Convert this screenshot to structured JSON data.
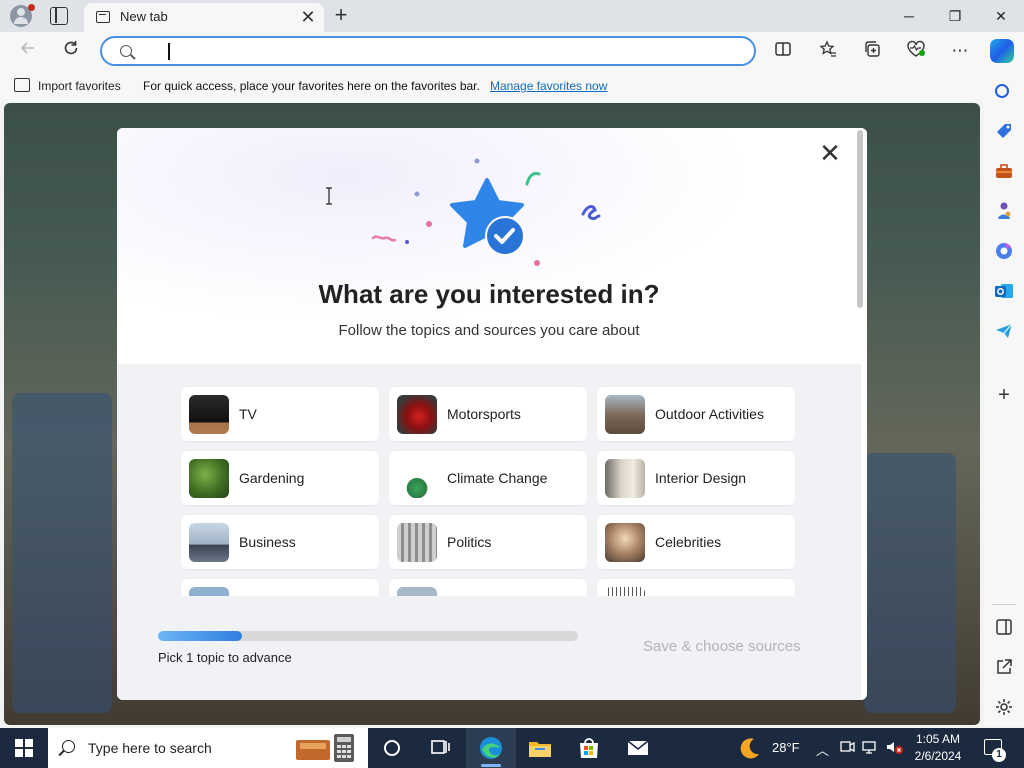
{
  "browser": {
    "tab_title": "New tab",
    "tab_close_glyph": "✕",
    "new_tab_glyph": "+",
    "window_controls": {
      "minimize": "─",
      "restore": "❐",
      "close": "✕"
    },
    "address_value": ""
  },
  "favorites_bar": {
    "import_label": "Import favorites",
    "hint_text": "For quick access, place your favorites here on the favorites bar.",
    "manage_link": "Manage favorites now"
  },
  "modal": {
    "close_glyph": "✕",
    "title": "What are you interested in?",
    "subtitle": "Follow the topics and sources you care about",
    "topics": [
      {
        "label": "TV",
        "icon": "tv-thumb"
      },
      {
        "label": "Motorsports",
        "icon": "motorsports-thumb"
      },
      {
        "label": "Outdoor Activities",
        "icon": "outdoor-thumb"
      },
      {
        "label": "Gardening",
        "icon": "gardening-thumb"
      },
      {
        "label": "Climate Change",
        "icon": "climate-thumb"
      },
      {
        "label": "Interior Design",
        "icon": "interior-thumb"
      },
      {
        "label": "Business",
        "icon": "business-thumb"
      },
      {
        "label": "Politics",
        "icon": "politics-thumb"
      },
      {
        "label": "Celebrities",
        "icon": "celebrities-thumb"
      }
    ],
    "progress_label": "Pick 1 topic to advance",
    "progress_fraction": 0.2,
    "save_button": "Save & choose sources"
  },
  "taskbar": {
    "search_placeholder": "Type here to search",
    "weather_temp": "28°F",
    "time": "1:05 AM",
    "date": "2/6/2024",
    "notification_count": "1"
  },
  "colors": {
    "accent": "#2f7de0",
    "link": "#0f6cbd",
    "star": "#2f86e8",
    "taskbar": "#1b2a3f"
  }
}
